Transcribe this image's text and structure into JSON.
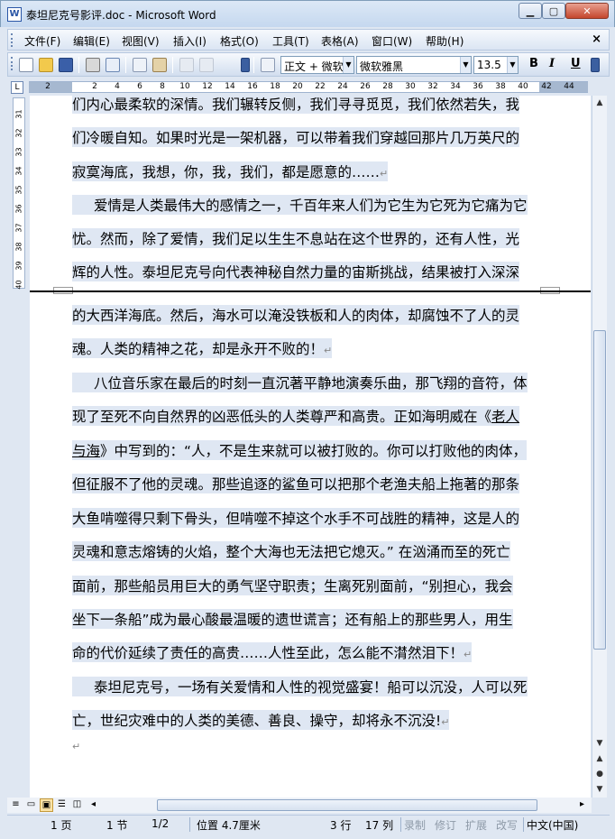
{
  "window": {
    "title": "泰坦尼克号影评.doc - Microsoft Word",
    "min_label": "▁",
    "max_label": "▢",
    "close_label": "✕"
  },
  "menu": {
    "items": [
      "文件(F)",
      "编辑(E)",
      "视图(V)",
      "插入(I)",
      "格式(O)",
      "工具(T)",
      "表格(A)",
      "窗口(W)",
      "帮助(H)"
    ],
    "close_doc": "×"
  },
  "toolbar": {
    "style_value": "正文 + 微软",
    "font_value": "微软雅黑",
    "size_value": "13.5",
    "bold": "B",
    "italic": "I",
    "underline": "U"
  },
  "ruler": {
    "tab_marker": "L",
    "numbers": [
      "2",
      "2",
      "4",
      "6",
      "8",
      "10",
      "12",
      "14",
      "16",
      "18",
      "20",
      "22",
      "24",
      "26",
      "28",
      "30",
      "32",
      "34",
      "36",
      "38",
      "40",
      "42",
      "44"
    ],
    "vnumbers": [
      "31",
      "32",
      "33",
      "34",
      "35",
      "36",
      "37",
      "38",
      "39",
      "40"
    ]
  },
  "document": {
    "lines": [
      {
        "text": "们内心最柔软的深情。我们辗转反侧，我们寻寻觅觅，我们依然若失，我",
        "indent": false
      },
      {
        "text": "们冷暖自知。如果时光是一架机器，可以带着我们穿越回那片几万英尺的",
        "indent": false
      },
      {
        "text": "寂寞海底，我想，你，我，我们，都是愿意的……",
        "indent": false,
        "para_end": true
      },
      {
        "text": "爱情是人类最伟大的感情之一，千百年来人们为它生为它死为它痛为它",
        "indent": true
      },
      {
        "text": "忧。然而，除了爱情，我们足以生生不息站在这个世界的，还有人性，光",
        "indent": false
      },
      {
        "text": "辉的人性。泰坦尼克号向代表神秘自然力量的宙斯挑战，结果被打入深深",
        "indent": false
      },
      {
        "text": "的大西洋海底。然后，海水可以淹没铁板和人的肉体，却腐蚀不了人的灵",
        "indent": false
      },
      {
        "text": "魂。人类的精神之花，却是永开不败的！",
        "indent": false,
        "para_end": true
      },
      {
        "text": "八位音乐家在最后的时刻一直沉著平静地演奏乐曲，那飞翔的音符，体",
        "indent": true
      },
      {
        "text": "现了至死不向自然界的凶恶低头的人类尊严和高贵。正如海明威在《老人",
        "indent": false
      },
      {
        "text": "与海》中写到的：“人，不是生来就可以被打败的。你可以打败他的肉体，",
        "indent": false
      },
      {
        "text": "但征服不了他的灵魂。那些追逐的鲨鱼可以把那个老渔夫船上拖著的那条",
        "indent": false
      },
      {
        "text": "大鱼啃噬得只剩下骨头，但啃噬不掉这个水手不可战胜的精神，这是人的",
        "indent": false
      },
      {
        "text": "灵魂和意志熔铸的火焰，整个大海也无法把它熄灭。” 在汹涌而至的死亡",
        "indent": false
      },
      {
        "text": "面前，那些船员用巨大的勇气坚守职责；生离死别面前，“别担心，我会",
        "indent": false
      },
      {
        "text": "坐下一条船”成为最心酸最温暖的遗世谎言；还有船上的那些男人，用生",
        "indent": false
      },
      {
        "text": "命的代价延续了责任的高贵……人性至此，怎么能不潸然泪下！",
        "indent": false,
        "para_end": true
      },
      {
        "text": "泰坦尼克号，一场有关爱情和人性的视觉盛宴！船可以沉没，人可以死",
        "indent": true
      },
      {
        "text": "亡，世纪灾难中的人类的美德、善良、操守，却将永不沉没!",
        "indent": false,
        "para_end": true
      }
    ],
    "para_mark": "↵"
  },
  "statusbar": {
    "page": "1 页",
    "section": "1 节",
    "pages": "1/2",
    "position": "位置 4.7厘米",
    "line": "3 行",
    "column": "17 列",
    "rec": "录制",
    "trk": "修订",
    "ext": "扩展",
    "ovr": "改写",
    "language": "中文(中国)"
  }
}
